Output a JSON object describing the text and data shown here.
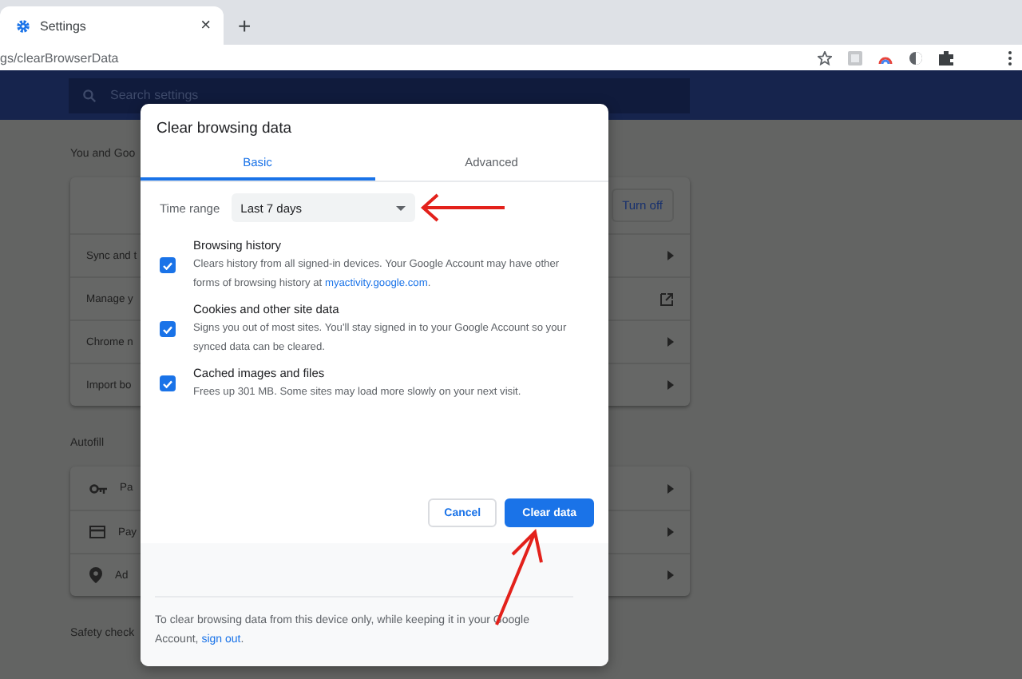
{
  "browser": {
    "tab": {
      "title": "Settings",
      "close": "×"
    },
    "new_tab": "+",
    "address": "gs/clearBrowserData"
  },
  "settings": {
    "search": {
      "placeholder": "Search settings"
    },
    "sections": [
      {
        "heading": "You and Goo",
        "rows": [
          {
            "kind": "button",
            "label": "Turn off"
          },
          {
            "kind": "submenu",
            "text": "Sync and t"
          },
          {
            "kind": "external",
            "text": "Manage y"
          },
          {
            "kind": "submenu",
            "text": "Chrome n"
          },
          {
            "kind": "submenu",
            "text": "Import bo"
          }
        ]
      },
      {
        "heading": "Autofill",
        "rows": [
          {
            "kind": "submenu",
            "text": "Pa"
          },
          {
            "kind": "submenu",
            "text": "Pay"
          },
          {
            "kind": "submenu",
            "text": "Ad"
          }
        ]
      },
      {
        "heading": "Safety check"
      }
    ]
  },
  "dialog": {
    "title": "Clear browsing data",
    "tabs": [
      {
        "label": "Basic",
        "selected": true
      },
      {
        "label": "Advanced",
        "selected": false
      }
    ],
    "time_range": {
      "label": "Time range",
      "value": "Last 7 days"
    },
    "options": [
      {
        "title": "Browsing history",
        "description": "Clears history from all signed-in devices. Your Google Account may have other forms of browsing history at ",
        "link": "myactivity.google.com",
        "after": ".",
        "checked": true
      },
      {
        "title": "Cookies and other site data",
        "description": "Signs you out of most sites. You'll stay signed in to your Google Account so your synced data can be cleared.",
        "checked": true
      },
      {
        "title": "Cached images and files",
        "description": "Frees up 301 MB. Some sites may load more slowly on your next visit.",
        "checked": true
      }
    ],
    "buttons": [
      {
        "label": "Cancel",
        "kind": "secondary"
      },
      {
        "label": "Clear data",
        "kind": "primary"
      }
    ],
    "footer": {
      "text": "To clear browsing data from this device only, while keeping it in your Google Account, ",
      "link": "sign out",
      "after": "."
    }
  }
}
